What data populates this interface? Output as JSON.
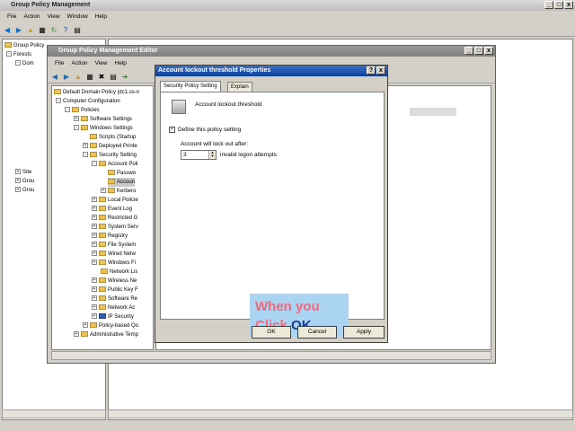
{
  "gpm": {
    "title": "Group Policy Management",
    "menu": [
      "File",
      "Action",
      "View",
      "Window",
      "Help"
    ],
    "tree": [
      {
        "label": "Group Policy"
      },
      {
        "label": "Forests"
      },
      {
        "label": "Dom"
      },
      {
        "label": "Site"
      },
      {
        "label": "Grou"
      },
      {
        "label": "Grou"
      }
    ]
  },
  "gpme": {
    "title": "Group Policy Management Editor",
    "menu": [
      "File",
      "Action",
      "View",
      "Help"
    ],
    "tree": [
      {
        "label": "Default Domain Policy [dc1.ss-n"
      },
      {
        "label": "Computer Configuration"
      },
      {
        "label": "Policies"
      },
      {
        "label": "Software Settings"
      },
      {
        "label": "Windows Settings"
      },
      {
        "label": "Scripts (Startup"
      },
      {
        "label": "Deployed Printe"
      },
      {
        "label": "Security Setting"
      },
      {
        "label": "Account Poli"
      },
      {
        "label": "Passwo"
      },
      {
        "label": "Accoun"
      },
      {
        "label": "Kerbero"
      },
      {
        "label": "Local Policie"
      },
      {
        "label": "Event Log"
      },
      {
        "label": "Restricted G"
      },
      {
        "label": "System Serv"
      },
      {
        "label": "Registry"
      },
      {
        "label": "File System"
      },
      {
        "label": "Wired Netw"
      },
      {
        "label": "Windows Fi"
      },
      {
        "label": "Network Lis"
      },
      {
        "label": "Wireless Ne"
      },
      {
        "label": "Public Key F"
      },
      {
        "label": "Software Re"
      },
      {
        "label": "Network Ac"
      },
      {
        "label": "IP Security"
      },
      {
        "label": "Policy-based Qo"
      },
      {
        "label": "Administrative Temp"
      }
    ]
  },
  "dialog": {
    "title": "Account lockout threshold Properties",
    "help_btn": "?",
    "close_btn": "x",
    "tabs": [
      "Security Policy Setting",
      "Explain"
    ],
    "policy_name": "Account lockout threshold",
    "define_label": "Define this policy setting",
    "define_checked": "✓",
    "lockout_label": "Account will lock out after:",
    "attempts_value": "3",
    "attempts_suffix": "invalid logon attempts",
    "ok": "OK",
    "cancel": "Cancel",
    "apply": "Apply"
  },
  "callout": {
    "line1": "When you",
    "line2_prefix": "Click ",
    "line2_emph": "OK",
    "line2_suffix": ".",
    "bg": "#aad4f2",
    "text_color": "#f06a7a",
    "emph_color": "#1b3a8a"
  }
}
